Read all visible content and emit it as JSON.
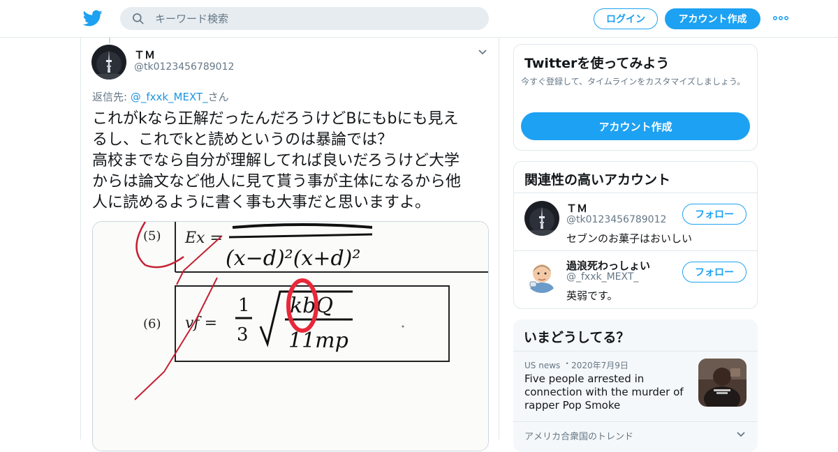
{
  "header": {
    "search_placeholder": "キーワード検索",
    "login_label": "ログイン",
    "signup_label": "アカウント作成",
    "brand_color": "#1da1f2"
  },
  "tweet": {
    "author_name": "ＴＭ",
    "author_handle": "@tk0123456789012",
    "reply_prefix": "返信先: ",
    "reply_to": "@_fxxk_MEXT_",
    "reply_suffix": "さん",
    "text_lines": [
      "これがkなら正解だったんだろうけどBにもbにも見え",
      "るし、これでkと読めというのは暴論では？",
      "高校までなら自分が理解してれば良いだろうけど大学",
      "からは論文など他人に見て貰う事が主体になるから他",
      "人に読めるように書く事も大事だと思いますよ。"
    ]
  },
  "media": {
    "label_5": "(5)",
    "label_6": "(6)",
    "ex_label": "Ex =",
    "vf_label": "vf =",
    "den_5": "(x−d)²(x+d)²",
    "frac_num": "1",
    "frac_den": "3",
    "root_num": "kbQ",
    "root_den": "11mp"
  },
  "signup_card": {
    "title": "Twitterを使ってみよう",
    "subtitle": "今すぐ登録して、タイムラインをカスタマイズしましょう。",
    "button_label": "アカウント作成"
  },
  "related": {
    "title": "関連性の高いアカウント",
    "accounts": [
      {
        "name": "ＴＭ",
        "handle": "@tk0123456789012",
        "bio": "セブンのお菓子はおいしい",
        "follow_label": "フォロー"
      },
      {
        "name": "過浪死わっしょい",
        "handle": "@_fxxk_MEXT_",
        "bio": "英弱です。",
        "follow_label": "フォロー"
      }
    ]
  },
  "whats_happening": {
    "title": "いまどうしてる？",
    "news_source": "US news",
    "news_date": "2020年7月9日",
    "news_title": "Five people arrested in connection with the murder of rapper Pop Smoke",
    "trend_location": "アメリカ合衆国のトレンド"
  }
}
